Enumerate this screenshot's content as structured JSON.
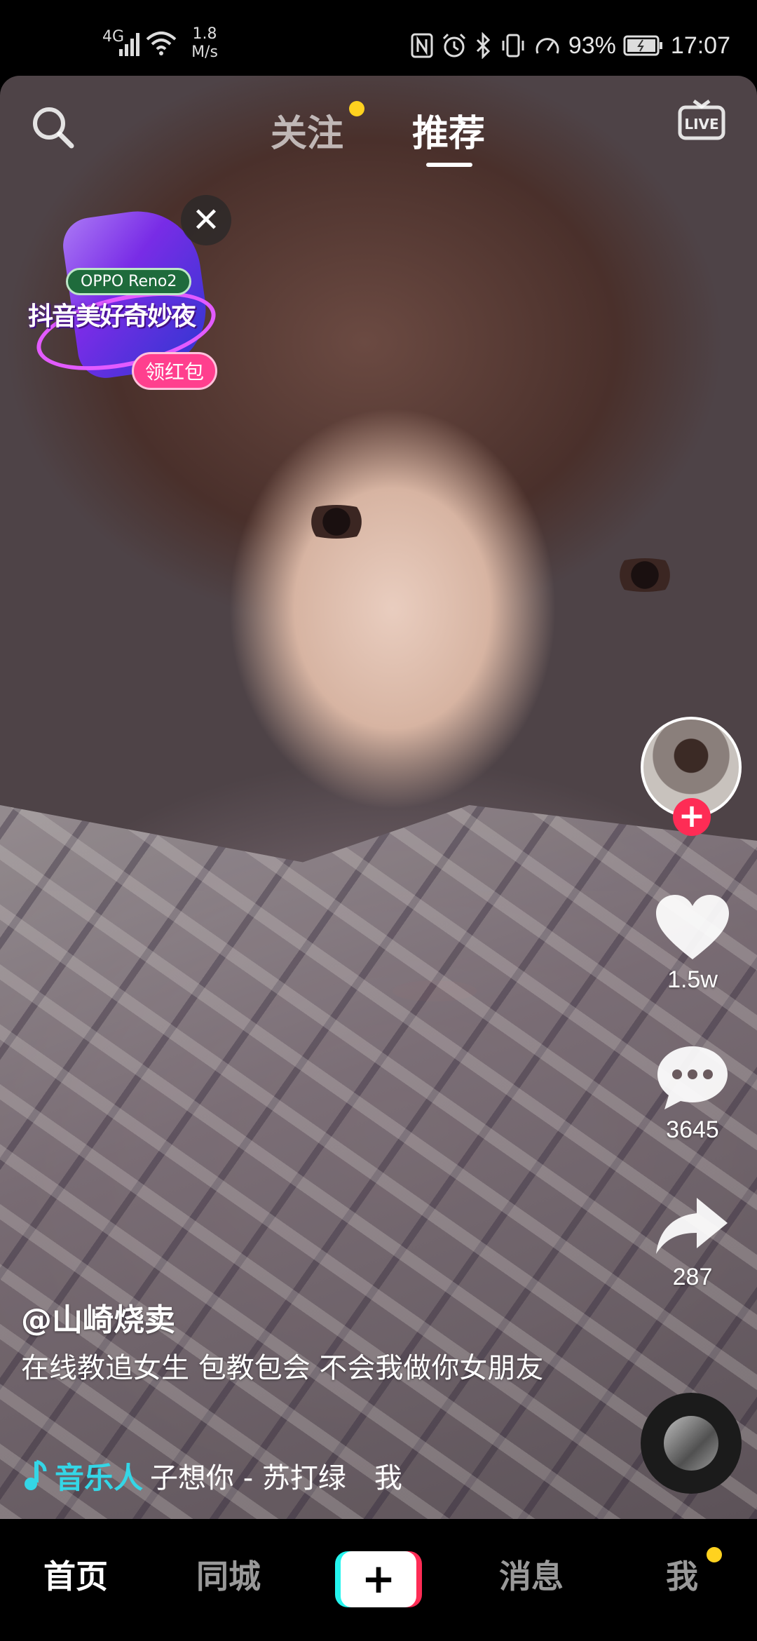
{
  "status_bar": {
    "network": "4G",
    "speed_value": "1.8",
    "speed_unit": "M/s",
    "battery_percent": "93%",
    "time": "17:07"
  },
  "top_nav": {
    "tab_follow": "关注",
    "tab_recommend": "推荐",
    "live_label": "LIVE"
  },
  "promo": {
    "tag": "OPPO Reno2",
    "title": "抖音美好奇妙夜",
    "button": "领红包",
    "close": "✕"
  },
  "actions": {
    "likes": "1.5w",
    "comments": "3645",
    "shares": "287",
    "follow_plus": "+"
  },
  "post": {
    "author": "@山崎烧卖",
    "description": "在线教追女生 包教包会 不会我做你女朋友",
    "music_tag": "音乐人",
    "music_title": "子想你 - 苏打绿　我"
  },
  "tab_bar": {
    "home": "首页",
    "nearby": "同城",
    "create": "+",
    "messages": "消息",
    "me": "我"
  },
  "colors": {
    "accent_pink": "#fe2c55",
    "accent_cyan": "#25f4ee",
    "music_tag": "#34d6e6",
    "notify_dot": "#ffd21f"
  },
  "icons": [
    "search-icon",
    "live-icon",
    "close-icon",
    "heart-icon",
    "comment-icon",
    "share-icon",
    "music-note-icon",
    "signal-icon",
    "wifi-icon",
    "nfc-icon",
    "alarm-icon",
    "bluetooth-icon",
    "vibrate-icon",
    "battery-icon"
  ]
}
